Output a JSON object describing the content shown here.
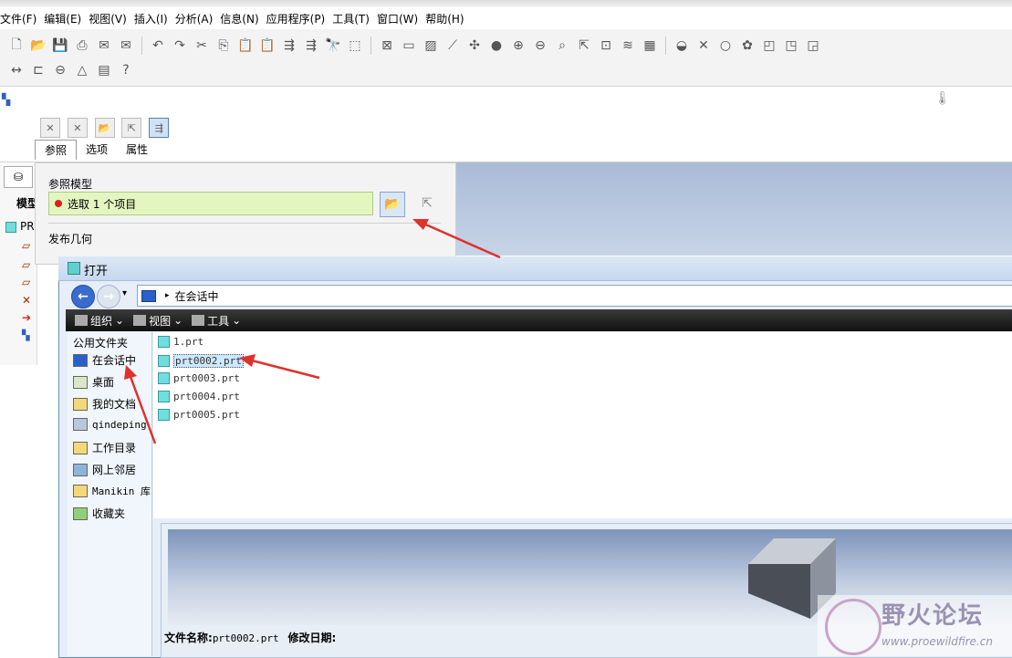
{
  "menu": [
    "文件(F)",
    "编辑(E)",
    "视图(V)",
    "插入(I)",
    "分析(A)",
    "信息(N)",
    "应用程序(P)",
    "工具(T)",
    "窗口(W)",
    "帮助(H)"
  ],
  "dashboard": {
    "tabs": [
      "参照",
      "选项",
      "属性"
    ],
    "ref_model_label": "参照模型",
    "ref_field_text": "选取 1 个项目",
    "publish_geometry_label": "发布几何"
  },
  "left_panel": {
    "tab_label": "模型",
    "tree_root": "PR"
  },
  "dialog": {
    "title": "打开",
    "address": "在会话中",
    "commands": [
      "组织",
      "视图",
      "工具"
    ],
    "sidebar_header": "公用文件夹",
    "sidebar_items": [
      "在会话中",
      "桌面",
      "我的文档",
      "qindeping",
      "工作目录",
      "网上邻居",
      "Manikin 库",
      "收藏夹"
    ],
    "files": [
      "1.prt",
      "prt0002.prt",
      "prt0003.prt",
      "prt0004.prt",
      "prt0005.prt"
    ],
    "selected_file_index": 1,
    "filename_label": "文件名称:",
    "filename_value": "prt0002.prt",
    "modified_label": "修改日期:"
  },
  "watermark": {
    "title": "野火论坛",
    "url": "www.proewildfire.cn"
  },
  "colors": {
    "ref_field_bg": "#e4f6c0",
    "accent_blue": "#3a6cd0",
    "cmdbar_dark": "#1a1a1a"
  }
}
